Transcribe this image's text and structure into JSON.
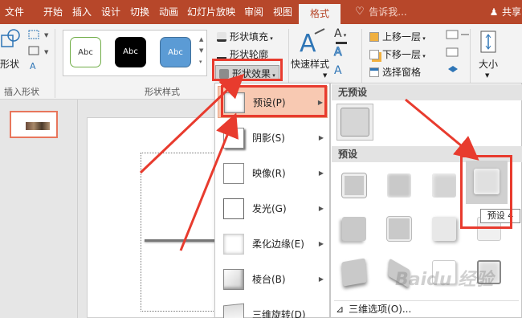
{
  "tabs": {
    "file": "文件",
    "home": "开始",
    "insert": "插入",
    "design": "设计",
    "transitions": "切换",
    "animations": "动画",
    "slideshow": "幻灯片放映",
    "review": "审阅",
    "view": "视图",
    "format": "格式",
    "tell_me": "告诉我...",
    "share": "共享"
  },
  "ribbon": {
    "insert_shape": {
      "shape_btn": "形状",
      "label": "插入形状"
    },
    "shape_styles": {
      "abc": "Abc",
      "label": "形状样式",
      "fill": "形状填充",
      "outline": "形状轮廓",
      "effects": "形状效果"
    },
    "wordart": {
      "quick_styles": "快速样式",
      "a": "A"
    },
    "arrange": {
      "bring_forward": "上移一层",
      "send_backward": "下移一层",
      "selection_pane": "选择窗格"
    },
    "size": {
      "label": "大小"
    }
  },
  "effects_menu": {
    "items": [
      {
        "label": "预设(P)"
      },
      {
        "label": "阴影(S)"
      },
      {
        "label": "映像(R)"
      },
      {
        "label": "发光(G)"
      },
      {
        "label": "柔化边缘(E)"
      },
      {
        "label": "棱台(B)"
      },
      {
        "label": "三维旋转(D)"
      }
    ]
  },
  "presets_submenu": {
    "no_preset": "无预设",
    "preset_header": "预设",
    "tooltip": "预设 4",
    "three_d_options": "三维选项(O)..."
  },
  "colors": {
    "accent": "#b7472a",
    "highlight": "#e83b2e",
    "menu_highlight": "#f8c9b2"
  }
}
